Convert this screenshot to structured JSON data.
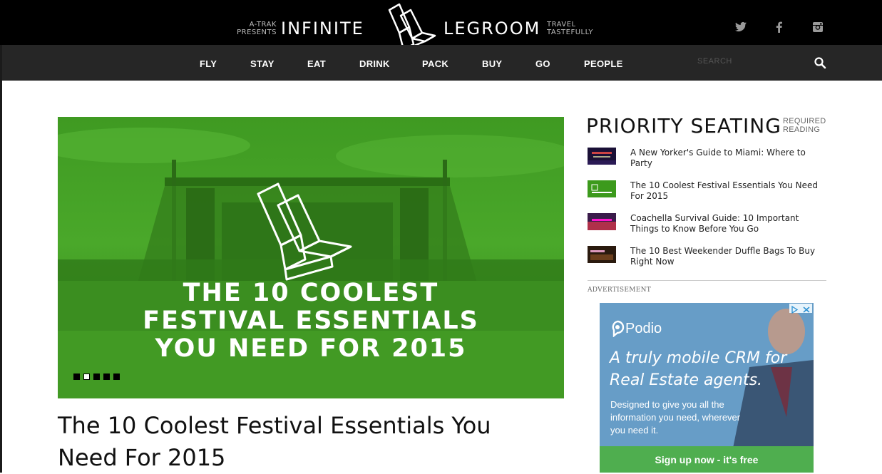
{
  "header": {
    "presents": "A-TRAK PRESENTS",
    "presents_line1": "A-TRAK",
    "presents_line2": "PRESENTS",
    "brand_word1": "INFINITE",
    "brand_word2": "LEGROOM",
    "tagline_line1": "TRAVEL",
    "tagline_line2": "TASTEFULLY",
    "social": [
      "twitter-icon",
      "facebook-icon",
      "instagram-icon"
    ]
  },
  "nav": {
    "items": [
      "FLY",
      "STAY",
      "EAT",
      "DRINK",
      "PACK",
      "BUY",
      "GO",
      "PEOPLE"
    ],
    "search_placeholder": "SEARCH"
  },
  "hero": {
    "title_lines": [
      "THE 10 COOLEST",
      "FESTIVAL ESSENTIALS",
      "YOU NEED FOR 2015"
    ],
    "slide_count": 5,
    "active_slide": 2,
    "tint_color": "#3c9a1c"
  },
  "article": {
    "title": "The 10 Coolest Festival Essentials You Need For 2015"
  },
  "sidebar": {
    "heading": "PRIORITY SEATING",
    "sub_line1": "REQUIRED",
    "sub_line2": "READING",
    "items": [
      {
        "text": "A New Yorker's Guide to Miami: Where to Party"
      },
      {
        "text": "The 10 Coolest Festival Essentials You Need For 2015"
      },
      {
        "text": "Coachella Survival Guide: 10 Important Things to Know Before You Go"
      },
      {
        "text": "The 10 Best Weekender Duffle Bags To Buy Right Now"
      }
    ],
    "ad_label": "ADVERTISEMENT"
  },
  "ad": {
    "brand": "Podio",
    "headline": "A truly mobile CRM for Real Estate agents.",
    "body": "Designed to give you all the information you need, wherever you need it.",
    "cta": "Sign up now - it's free"
  }
}
